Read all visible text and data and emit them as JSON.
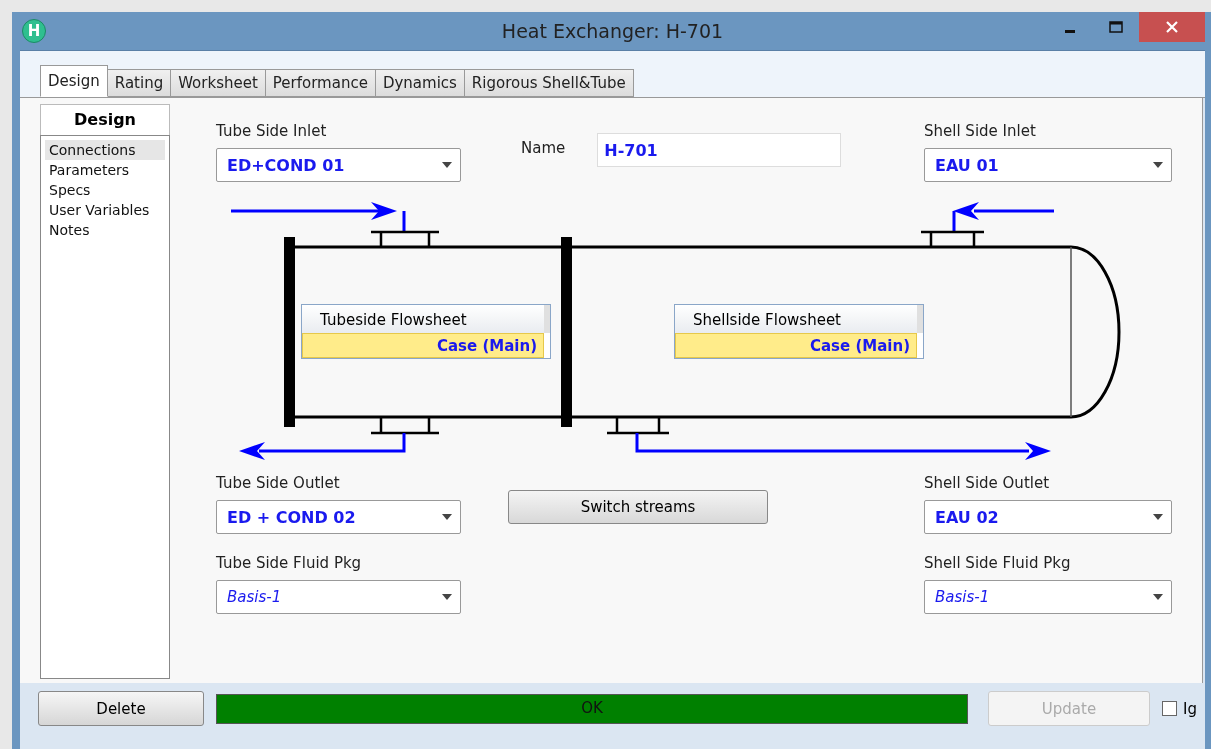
{
  "window": {
    "title": "Heat Exchanger: H-701",
    "app_icon_letter": "H"
  },
  "tabs": [
    {
      "label": "Design",
      "selected": true
    },
    {
      "label": "Rating",
      "selected": false
    },
    {
      "label": "Worksheet",
      "selected": false
    },
    {
      "label": "Performance",
      "selected": false
    },
    {
      "label": "Dynamics",
      "selected": false
    },
    {
      "label": "Rigorous Shell&Tube",
      "selected": false
    }
  ],
  "sidebar": {
    "title": "Design",
    "items": [
      {
        "label": "Connections",
        "selected": true
      },
      {
        "label": "Parameters",
        "selected": false
      },
      {
        "label": "Specs",
        "selected": false
      },
      {
        "label": "User Variables",
        "selected": false
      },
      {
        "label": "Notes",
        "selected": false
      }
    ]
  },
  "tube_side_inlet": {
    "label": "Tube Side Inlet",
    "value": "ED+COND 01",
    "kind": "stream"
  },
  "name": {
    "label": "Name",
    "value": "H-701"
  },
  "shell_side_inlet": {
    "label": "Shell Side Inlet",
    "value": "EAU 01",
    "kind": "stream"
  },
  "tubeside_flowsheet": {
    "title": "Tubeside Flowsheet",
    "value": "Case (Main)"
  },
  "shellside_flowsheet": {
    "title": "Shellside Flowsheet",
    "value": "Case (Main)"
  },
  "tube_side_outlet": {
    "label": "Tube Side Outlet",
    "value": "ED + COND 02",
    "kind": "stream"
  },
  "switch_button": "Switch streams",
  "shell_side_outlet": {
    "label": "Shell Side Outlet",
    "value": "EAU 02",
    "kind": "stream"
  },
  "tube_side_fluid_pkg": {
    "label": "Tube Side Fluid Pkg",
    "value": "Basis-1",
    "kind": "package"
  },
  "shell_side_fluid_pkg": {
    "label": "Shell Side Fluid Pkg",
    "value": "Basis-1",
    "kind": "package"
  },
  "bottom_bar": {
    "delete_button": "Delete",
    "status": "OK",
    "update_button": {
      "label": "Update",
      "disabled": true
    },
    "ignored_checkbox": {
      "label": "Ig",
      "checked": false
    }
  }
}
